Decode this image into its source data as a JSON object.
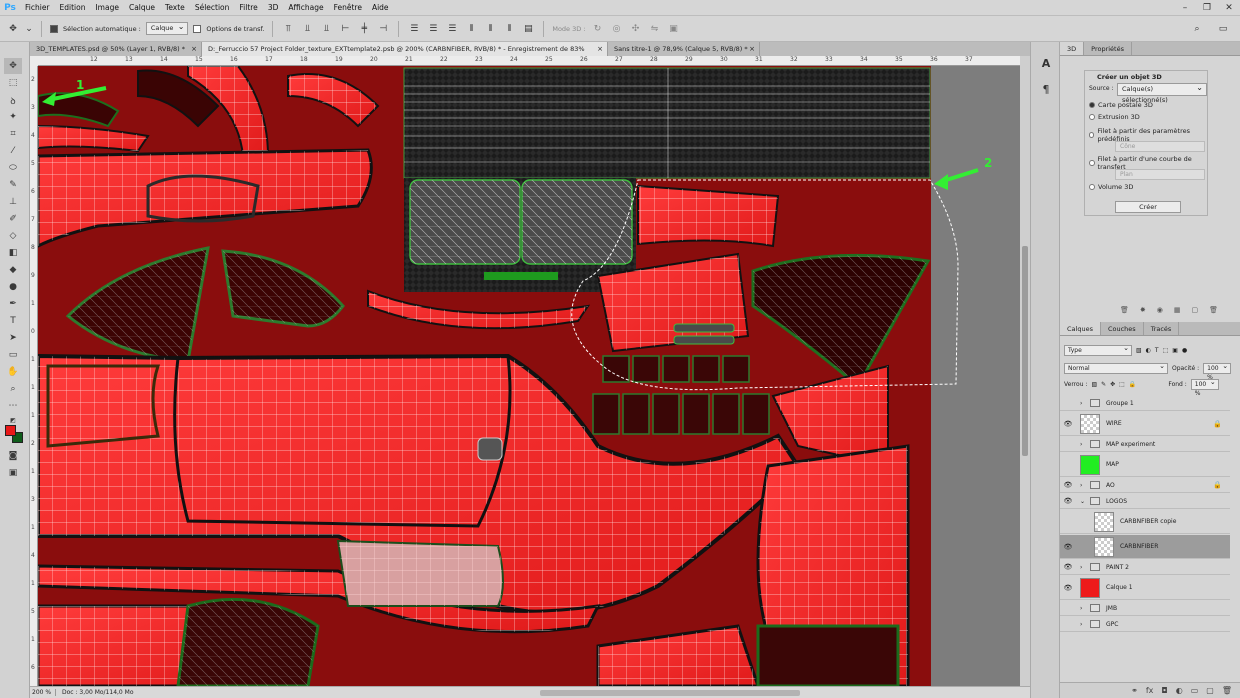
{
  "app": {
    "logo": "Ps"
  },
  "menu": [
    "Fichier",
    "Edition",
    "Image",
    "Calque",
    "Texte",
    "Sélection",
    "Filtre",
    "3D",
    "Affichage",
    "Fenêtre",
    "Aide"
  ],
  "options": {
    "auto_select_label": "Sélection automatique :",
    "auto_select_value": "Calque",
    "transform_label": "Options de transf.",
    "mode3d_label": "Mode 3D :"
  },
  "doc_tabs": [
    {
      "label": "3D_TEMPLATES.psd @ 50% (Layer 1, RVB/8) *",
      "active": false
    },
    {
      "label": "D:_Ferruccio 57 Project Folder_texture_EXTtemplate2.psb @ 200% (CARBNFIBER, RVB/8) * - Enregistrement de 83%",
      "active": true
    },
    {
      "label": "Sans titre-1 @ 78,9% (Calque 5, RVB/8) *",
      "active": false
    }
  ],
  "ruler_h": [
    "12",
    "13",
    "14",
    "15",
    "16",
    "17",
    "18",
    "19",
    "20",
    "21",
    "22",
    "23",
    "24",
    "25",
    "26",
    "27",
    "28",
    "29",
    "30",
    "31",
    "32",
    "33",
    "34",
    "35",
    "36",
    "37"
  ],
  "ruler_v": [
    "2",
    "3",
    "4",
    "5",
    "6",
    "7",
    "8",
    "9",
    "1",
    "0",
    "1",
    "1",
    "1",
    "2",
    "1",
    "3",
    "1",
    "4",
    "1",
    "5",
    "1",
    "6"
  ],
  "annotations": [
    {
      "label": "1"
    },
    {
      "label": "2"
    }
  ],
  "status": {
    "zoom": "200 %",
    "doc": "Doc : 3,00 Mo/114,0 Mo"
  },
  "panel3d": {
    "tabs": [
      "3D",
      "Propriétés"
    ],
    "title": "Créer un objet 3D",
    "source_label": "Source :",
    "source_value": "Calque(s) sélectionné(s)",
    "options": [
      {
        "label": "Carte postale 3D",
        "selected": true
      },
      {
        "label": "Extrusion 3D",
        "selected": false
      },
      {
        "label": "Filet à partir des paramètres prédéfinis",
        "selected": false
      },
      {
        "label": "Filet à partir d'une courbe de transfert",
        "selected": false
      },
      {
        "label": "Volume 3D",
        "selected": false
      }
    ],
    "preset_value": "Cône",
    "curve_value": "Plan",
    "create_button": "Créer"
  },
  "layers_panel": {
    "tabs": [
      "Calques",
      "Couches",
      "Tracés"
    ],
    "filter_value": "Type",
    "blend_mode": "Normal",
    "opacity_label": "Opacité :",
    "opacity_value": "100 %",
    "lock_label": "Verrou :",
    "fill_label": "Fond :",
    "fill_value": "100 %",
    "layers": [
      {
        "name": "Groupe 1",
        "type": "group",
        "visible": false,
        "indent": 0
      },
      {
        "name": "WIRE",
        "type": "layer",
        "visible": true,
        "thumb": "checker",
        "locked": true,
        "indent": 0
      },
      {
        "name": "MAP experiment",
        "type": "group",
        "visible": false,
        "indent": 0
      },
      {
        "name": "MAP",
        "type": "layer",
        "visible": false,
        "thumb": "#22ee22",
        "indent": 0
      },
      {
        "name": "AO",
        "type": "group",
        "visible": true,
        "locked": true,
        "indent": 0
      },
      {
        "name": "LOGOS",
        "type": "group",
        "visible": true,
        "indent": 0,
        "open": true
      },
      {
        "name": "CARBNFIBER copie",
        "type": "layer",
        "visible": false,
        "thumb": "checker",
        "indent": 1
      },
      {
        "name": "CARBNFIBER",
        "type": "layer",
        "visible": true,
        "thumb": "checker",
        "indent": 1,
        "selected": true
      },
      {
        "name": "PAINT 2",
        "type": "group",
        "visible": true,
        "indent": 0
      },
      {
        "name": "Calque 1",
        "type": "layer",
        "visible": true,
        "thumb": "#ee1a1a",
        "indent": 0
      },
      {
        "name": "JMB",
        "type": "group",
        "visible": false,
        "indent": 0
      },
      {
        "name": "GPC",
        "type": "group",
        "visible": false,
        "indent": 0
      }
    ]
  },
  "colors": {
    "foreground": "#e81818",
    "background": "#0e5c1a",
    "accent": "#33ee33"
  }
}
